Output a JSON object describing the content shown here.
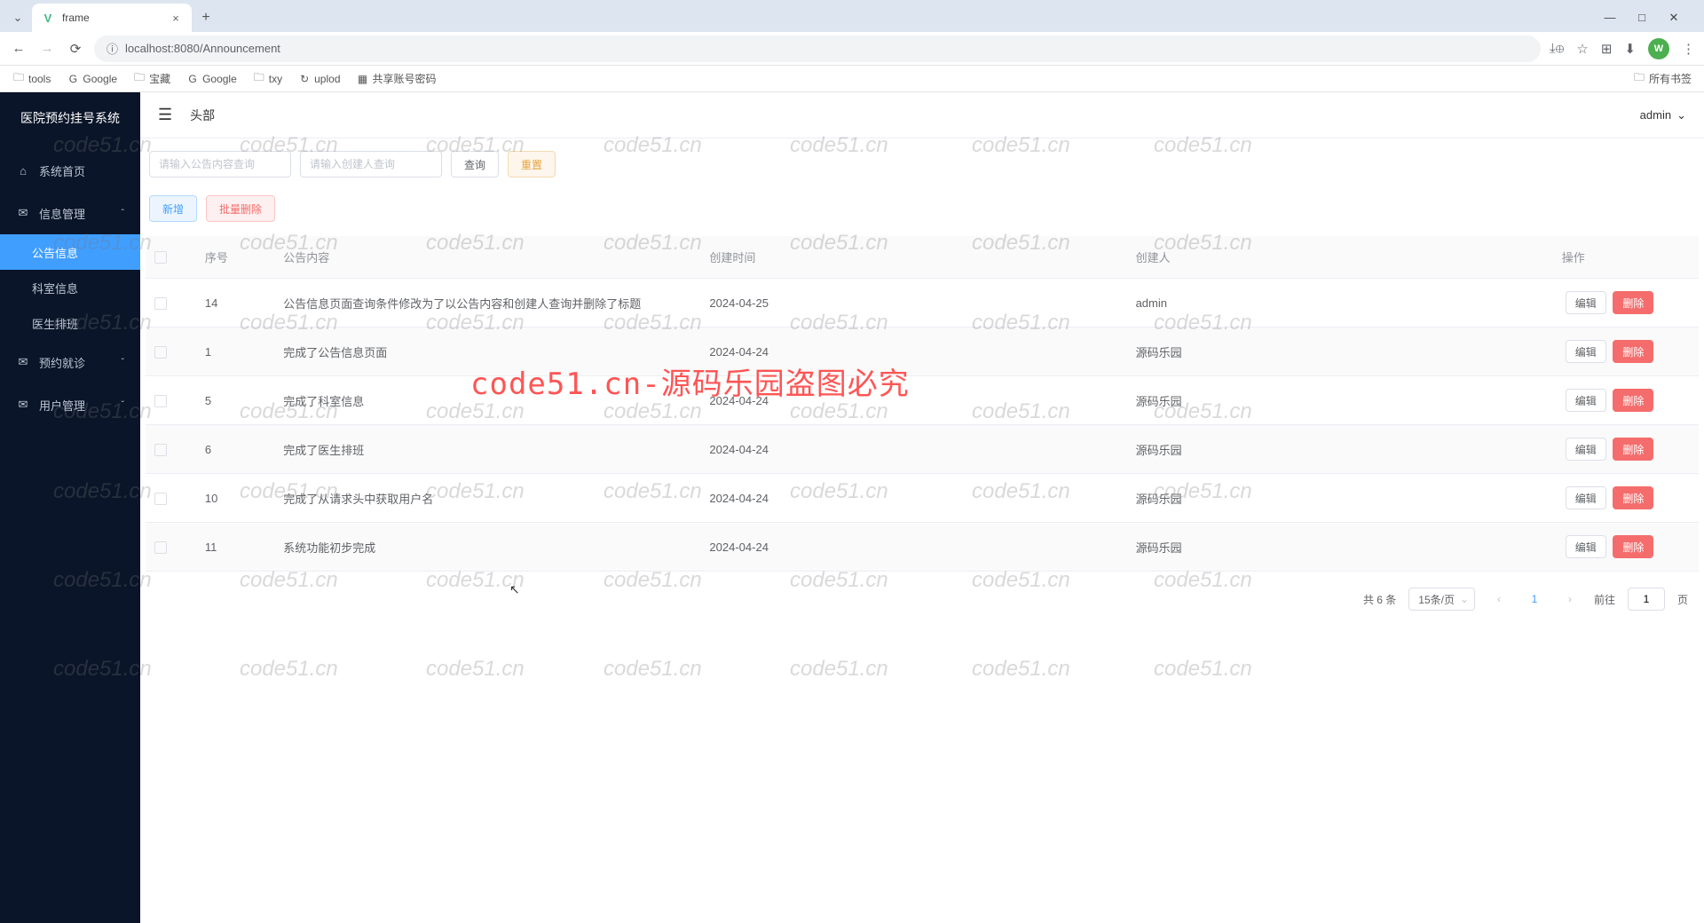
{
  "browser": {
    "tab_title": "frame",
    "url_protocol": "ⓘ",
    "url": "localhost:8080/Announcement",
    "avatar_letter": "W",
    "window_controls": {
      "min": "—",
      "max": "□",
      "close": "✕"
    }
  },
  "bookmarks": [
    {
      "icon": "🗀",
      "label": "tools"
    },
    {
      "icon": "G",
      "label": "Google"
    },
    {
      "icon": "🗀",
      "label": "宝藏"
    },
    {
      "icon": "G",
      "label": "Google"
    },
    {
      "icon": "🗀",
      "label": "txy"
    },
    {
      "icon": "↻",
      "label": "uplod"
    },
    {
      "icon": "▦",
      "label": "共享账号密码"
    }
  ],
  "bookmarks_right": {
    "icon": "🗀",
    "label": "所有书签"
  },
  "sidebar": {
    "title": "医院预约挂号系统",
    "items": [
      {
        "icon": "⌂",
        "label": "系统首页",
        "active": false,
        "hasArrow": false
      },
      {
        "icon": "✉",
        "label": "信息管理",
        "active": false,
        "hasArrow": true,
        "arrow": "ˆ"
      },
      {
        "icon": "",
        "label": "公告信息",
        "active": true,
        "sub": true
      },
      {
        "icon": "",
        "label": "科室信息",
        "active": false,
        "sub": true
      },
      {
        "icon": "",
        "label": "医生排班",
        "active": false,
        "sub": true
      },
      {
        "icon": "✉",
        "label": "预约就诊",
        "active": false,
        "hasArrow": true,
        "arrow": "ˇ"
      },
      {
        "icon": "✉",
        "label": "用户管理",
        "active": false,
        "hasArrow": true,
        "arrow": "ˇ"
      }
    ]
  },
  "header": {
    "hamburger": "☰",
    "title": "头部",
    "user": "admin",
    "user_arrow": "⌄"
  },
  "filters": {
    "content_placeholder": "请输入公告内容查询",
    "creator_placeholder": "请输入创建人查询",
    "search_btn": "查询",
    "reset_btn": "重置"
  },
  "actions": {
    "add_btn": "新增",
    "batch_delete_btn": "批量删除"
  },
  "table": {
    "headers": {
      "seq": "序号",
      "content": "公告内容",
      "time": "创建时间",
      "creator": "创建人",
      "ops": "操作"
    },
    "edit_btn": "编辑",
    "delete_btn": "删除",
    "rows": [
      {
        "seq": "14",
        "content": "公告信息页面查询条件修改为了以公告内容和创建人查询并删除了标题",
        "time": "2024-04-25",
        "creator": "admin"
      },
      {
        "seq": "1",
        "content": "完成了公告信息页面",
        "time": "2024-04-24",
        "creator": "源码乐园"
      },
      {
        "seq": "5",
        "content": "完成了科室信息",
        "time": "2024-04-24",
        "creator": "源码乐园"
      },
      {
        "seq": "6",
        "content": "完成了医生排班",
        "time": "2024-04-24",
        "creator": "源码乐园"
      },
      {
        "seq": "10",
        "content": "完成了从请求头中获取用户名",
        "time": "2024-04-24",
        "creator": "源码乐园"
      },
      {
        "seq": "11",
        "content": "系统功能初步完成",
        "time": "2024-04-24",
        "creator": "源码乐园"
      }
    ]
  },
  "pagination": {
    "total": "共 6 条",
    "page_size": "15条/页",
    "prev": "‹",
    "current": "1",
    "next": "›",
    "goto_prefix": "前往",
    "goto_value": "1",
    "goto_suffix": "页"
  },
  "watermark": {
    "text": "code51.cn",
    "main_text": "code51.cn-源码乐园盗图必究"
  }
}
